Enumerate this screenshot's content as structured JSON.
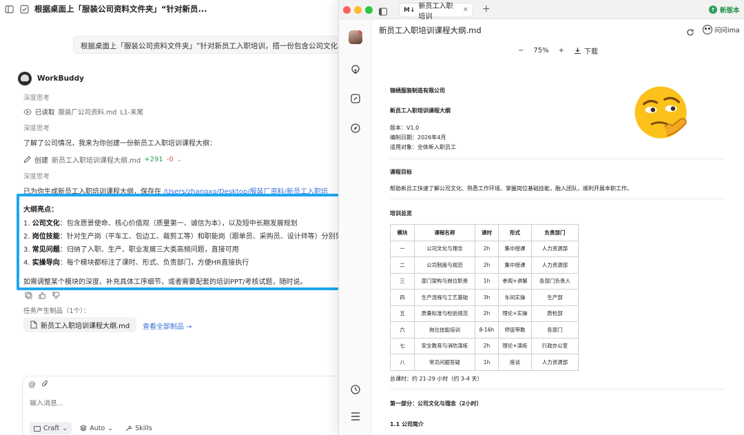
{
  "left_app": {
    "chat_title": "根据桌面上「服装公司资料文件夹」“针对新员...",
    "user_message": "根据桌面上「服装公司资料文件夹」“针对新员工入职培训，搭一份包含公司文化、岗",
    "bot_name": "WorkBuddy",
    "thinking_1": "深度思考",
    "read_label": "已读取",
    "read_file": "服装厂公司资料.md",
    "read_range": "L1-末尾",
    "thinking_2": "深度思考",
    "intro_text": "了解了公司情况，我来为你创建一份新员工入职培训课程大纲：",
    "create_label": "创建",
    "create_file": "新员工入职培训课程大纲.md",
    "create_plus": "+291",
    "create_minus": "-0",
    "thinking_3": "深度思考",
    "saved_prefix": "已为你生成新员工入职培训课程大纲，保存在",
    "saved_path": "/Users/zhangxq/Desktop/服装厂资料/新员工入职培",
    "highlights": {
      "title": "大纲亮点：",
      "items": [
        {
          "num": "1.",
          "head": "公司文化",
          "text": "：包含愿景使命、核心价值观（质量第一、诚信为本），以及短中长期发展规划"
        },
        {
          "num": "2.",
          "head": "岗位技能",
          "text": "：针对生产岗（平车工、包边工、裁剪工等）和职能岗（跟单员、采购员、设计师等）分别列"
        },
        {
          "num": "3.",
          "head": "常见问题",
          "text": "：归纳了入职、生产、职业发展三大类高频问题，直接可用"
        },
        {
          "num": "4.",
          "head": "实操导向",
          "text": "：每个模块都标注了课时、形式、负责部门，方便HR直接执行"
        }
      ],
      "note": "如需调整某个模块的深度、补充具体工序细节，或者需要配套的培训PPT/考核试题，随时说。"
    },
    "task_label": "任务产生制品（1个）：",
    "artifact_file": "新员工入职培训课程大纲.md",
    "view_all": "查看全部制品 →",
    "composer": {
      "placeholder": "输入消息...",
      "mode": "Craft",
      "model": "Auto",
      "skills": "Skills"
    }
  },
  "right_app": {
    "tab_badge": "M↓",
    "tab_title": "新员工入职培训",
    "new_version": "新版本",
    "file_title": "新员工入职培训课程大纲.md",
    "ima_label": "问问ima",
    "zoom": "75%",
    "download": "下载",
    "doc": {
      "company": "锦绣服装制造有限公司",
      "title": "新员工入职培训课程大纲",
      "version": "版本：V1.0",
      "date": "编制日期：2026年4月",
      "audience": "适用对象：全体新入职员工",
      "goal_heading": "课程目标",
      "goal_text": "帮助新员工快速了解公司文化、熟悉工作环境、掌握岗位基础技能，融入团队，顺利开展本职工作。",
      "overview_heading": "培训总览",
      "table_headers": [
        "模块",
        "课程名称",
        "课时",
        "形式",
        "负责部门"
      ],
      "table_rows": [
        [
          "一",
          "公司文化与理念",
          "2h",
          "集中授课",
          "人力资源部"
        ],
        [
          "二",
          "公司制度与规范",
          "2h",
          "集中授课",
          "人力资源部"
        ],
        [
          "三",
          "部门架构与岗位职责",
          "1h",
          "参观+讲解",
          "各部门负责人"
        ],
        [
          "四",
          "生产流程与工艺基础",
          "3h",
          "车间实操",
          "生产部"
        ],
        [
          "五",
          "质量标准与检验规范",
          "2h",
          "理论+实操",
          "质检部"
        ],
        [
          "六",
          "岗位技能培训",
          "8-16h",
          "师徒带教",
          "各部门"
        ],
        [
          "七",
          "安全教育与消防演练",
          "2h",
          "理论+演练",
          "行政办公室"
        ],
        [
          "八",
          "常见问题答疑",
          "1h",
          "座谈",
          "人力资源部"
        ]
      ],
      "total_hours": "总课时：约 21-29 小时（约 3-4 天）",
      "part_one": "第一部分：公司文化与理念（2小时）",
      "section_1_1": "1.1 公司简介"
    }
  },
  "colors": {
    "highlight_border": "#1ea7ef",
    "link": "#3a6fd8",
    "diff_add": "#2e9e5b",
    "diff_del": "#d9534f",
    "traffic_red": "#ff5f57",
    "traffic_yellow": "#febc2e",
    "traffic_green": "#28c840"
  }
}
